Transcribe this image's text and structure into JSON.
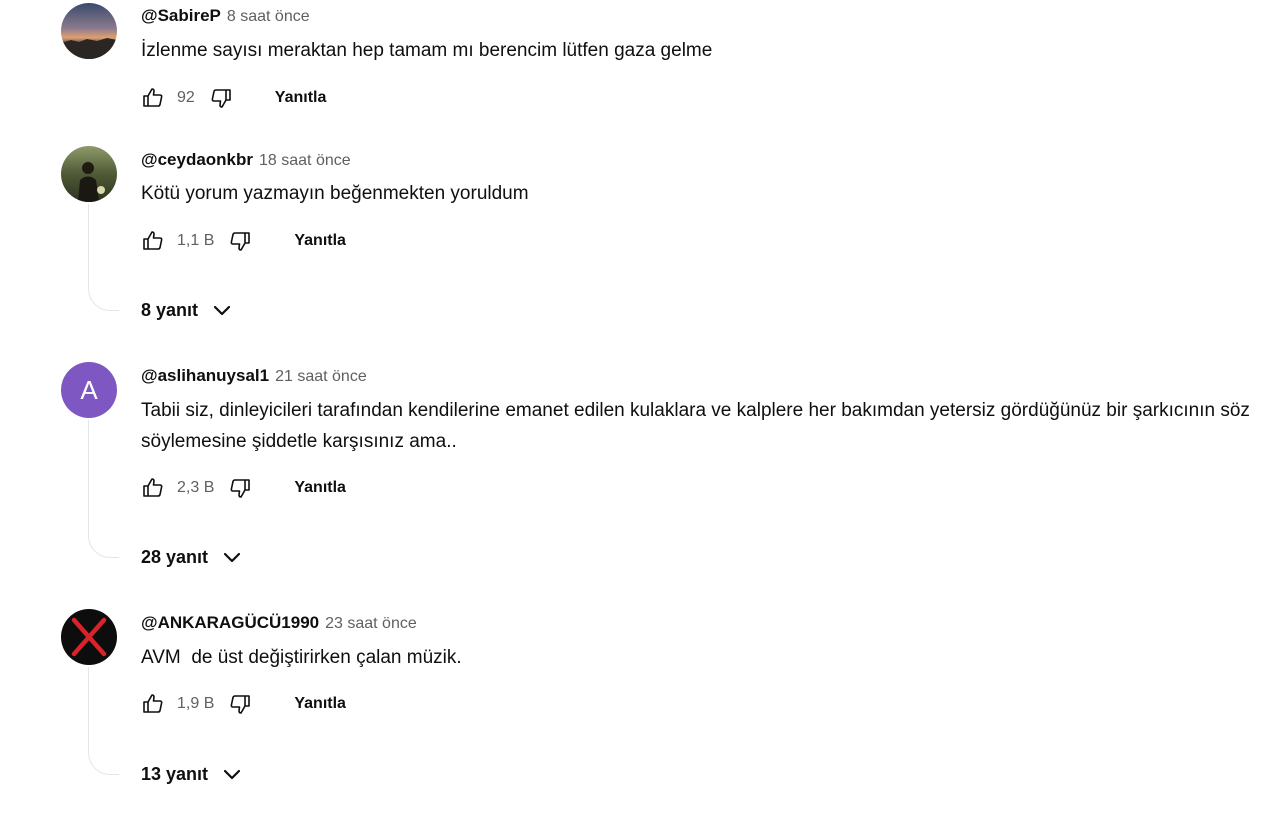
{
  "comments": [
    {
      "author": "@SabireP",
      "time": "8 saat önce",
      "text": "İzlenme sayısı meraktan hep tamam mı berencim lütfen gaza gelme",
      "likes": "92",
      "reply_label": "Yanıtla",
      "avatar_icon": "sunset-photo-avatar"
    },
    {
      "author": "@ceydaonkbr",
      "time": "18 saat önce",
      "text": "Kötü yorum yazmayın beğenmekten yoruldum",
      "likes": "1,1 B",
      "reply_label": "Yanıtla",
      "replies_label": "8 yanıt",
      "avatar_icon": "person-photo-avatar"
    },
    {
      "author": "@aslihanuysal1",
      "time": "21 saat önce",
      "text": "Tabii siz, dinleyicileri tarafından kendilerine emanet edilen kulaklara ve kalplere her bakımdan yetersiz gördüğünüz bir şarkıcının söz söylemesine şiddetle karşısınız ama..",
      "likes": "2,3 B",
      "reply_label": "Yanıtla",
      "replies_label": "28 yanıt",
      "avatar_letter": "A",
      "avatar_color": "#7e57c2"
    },
    {
      "author": "@ANKARAGÜCÜ1990",
      "time": "23 saat önce",
      "text": "AVM  de üst değiştirirken çalan müzik.",
      "likes": "1,9 B",
      "reply_label": "Yanıtla",
      "replies_label": "13 yanıt",
      "avatar_icon": "red-x-avatar"
    }
  ],
  "colors": {
    "text_primary": "#0f0f0f",
    "text_secondary": "#606060",
    "connector": "#e5e5e5"
  }
}
